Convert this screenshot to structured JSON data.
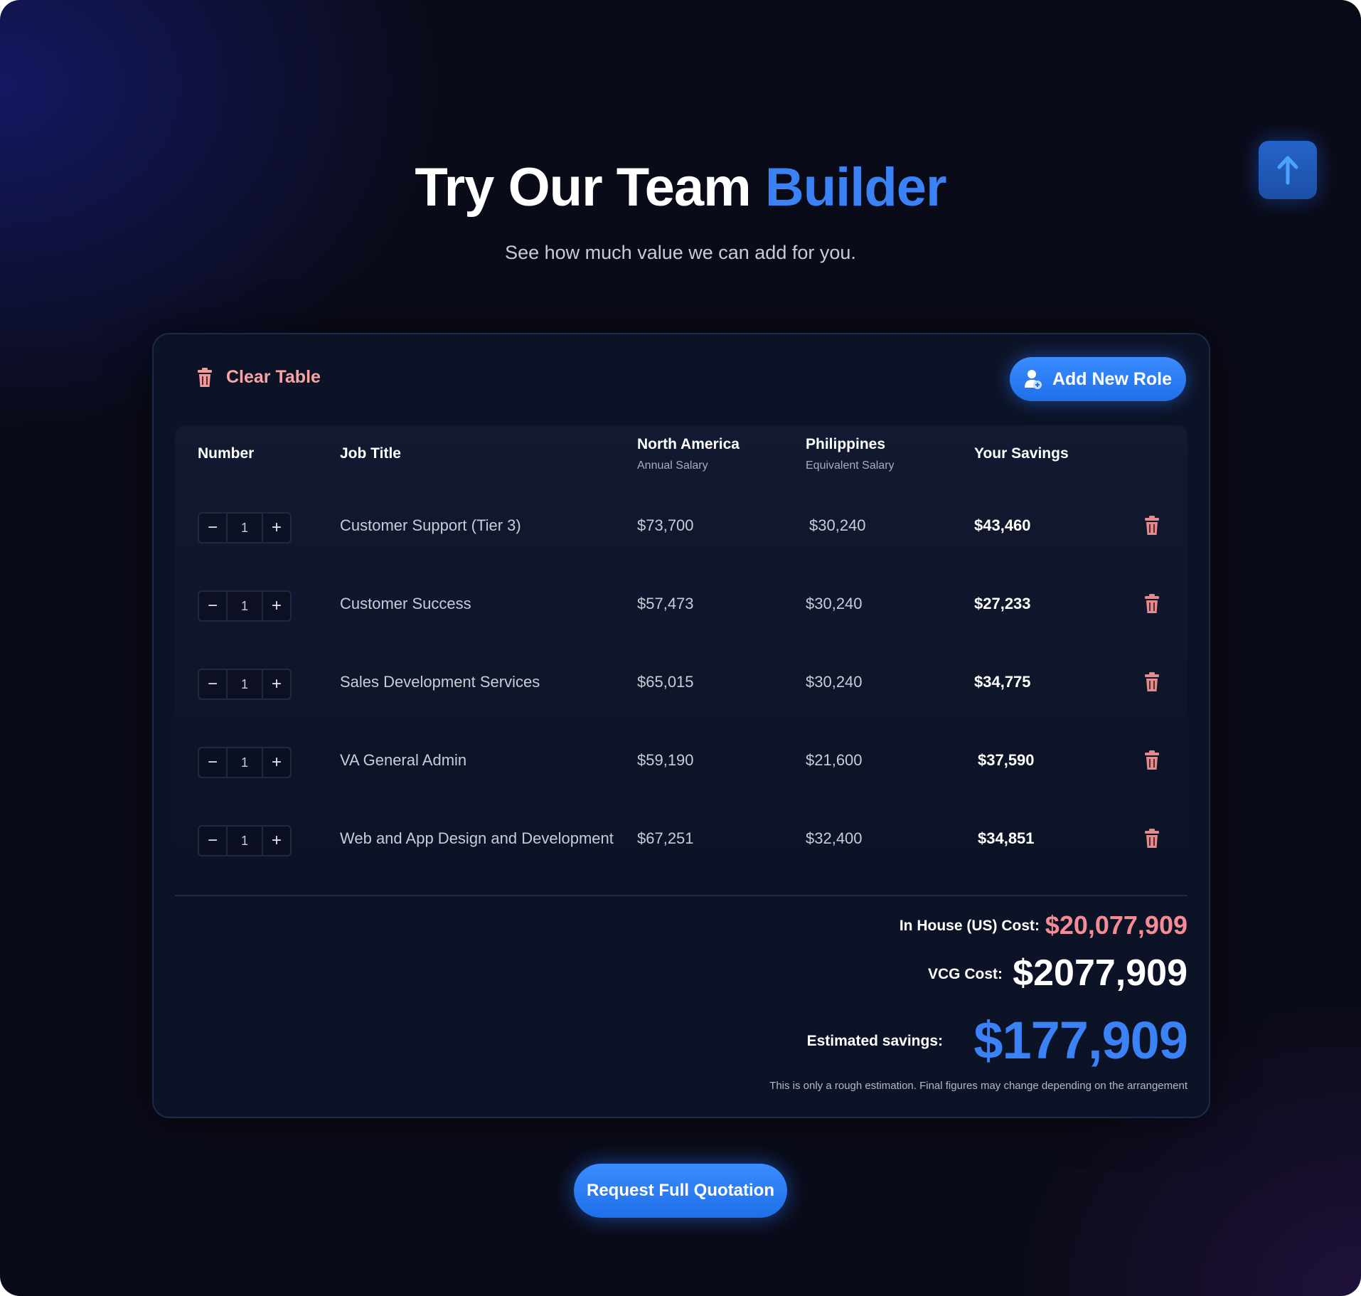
{
  "hero": {
    "title_main": "Try Our Team ",
    "title_accent": "Builder",
    "subtitle": "See how much value we can add for you."
  },
  "scroll_top": {
    "icon": "arrow-up-icon"
  },
  "toolbar": {
    "clear_label": "Clear Table",
    "add_role_label": "Add New Role"
  },
  "table": {
    "headers": {
      "number": "Number",
      "job_title": "Job Title",
      "north_america": "North America",
      "north_america_sub": "Annual Salary",
      "philippines": "Philippines",
      "philippines_sub": "Equivalent Salary",
      "savings": "Your Savings"
    },
    "rows": [
      {
        "qty": "1",
        "title": "Customer Support (Tier 3)",
        "na": "$73,700",
        "ph": "$30,240",
        "savings": "$43,460"
      },
      {
        "qty": "1",
        "title": "Customer Success",
        "na": "$57,473",
        "ph": "$30,240",
        "savings": "$27,233"
      },
      {
        "qty": "1",
        "title": "Sales Development Services",
        "na": "$65,015",
        "ph": "$30,240",
        "savings": "$34,775"
      },
      {
        "qty": "1",
        "title": "VA General Admin",
        "na": "$59,190",
        "ph": "$21,600",
        "savings": "$37,590"
      },
      {
        "qty": "1",
        "title": "Web and App Design and Development",
        "na": "$67,251",
        "ph": "$32,400",
        "savings": "$34,851"
      }
    ]
  },
  "summary": {
    "in_house_label": "In House (US) Cost:",
    "in_house_value": "$20,077,909",
    "vcg_label": "VCG Cost:",
    "vcg_value": "$2077,909",
    "savings_label": "Estimated savings:",
    "savings_value": "$177,909",
    "disclaimer": "This is only a rough estimation. Final figures may change depending on the arrangement"
  },
  "cta": {
    "label": "Request Full Quotation"
  },
  "colors": {
    "accent": "#3b82f6",
    "danger": "#f7a4a4",
    "background": "#0a0b18"
  }
}
